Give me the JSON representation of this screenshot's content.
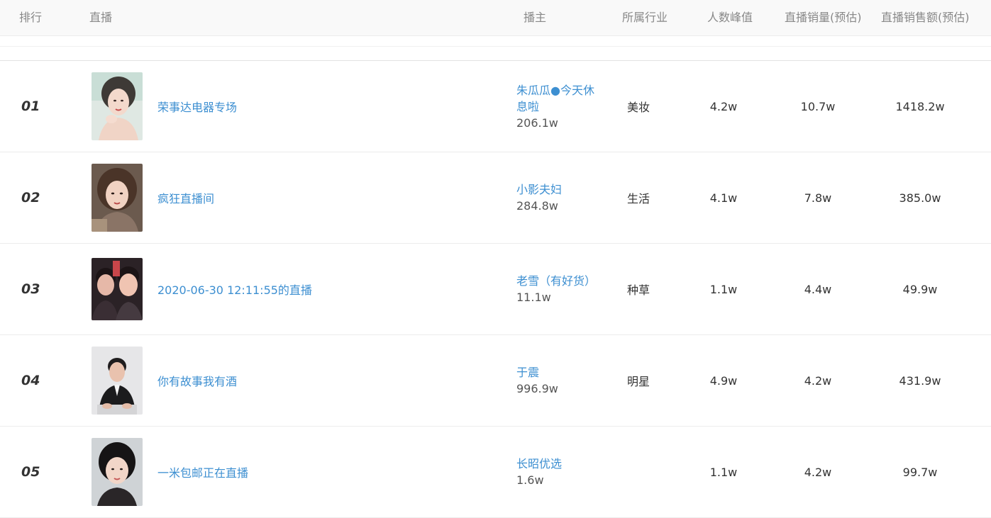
{
  "header": {
    "rank": "排行",
    "live": "直播",
    "anchor": "播主",
    "industry": "所属行业",
    "peak": "人数峰值",
    "sales": "直播销量(预估)",
    "amount": "直播销售额(预估)"
  },
  "rows": [
    {
      "rank": "01",
      "title": "荣事达电器专场",
      "anchor_name": "朱瓜瓜●今天休息啦",
      "anchor_fans": "206.1w",
      "industry": "美妆",
      "peak": "4.2w",
      "sales": "10.7w",
      "amount": "1418.2w"
    },
    {
      "rank": "02",
      "title": "疯狂直播间",
      "anchor_name": "小影夫妇",
      "anchor_fans": "284.8w",
      "industry": "生活",
      "peak": "4.1w",
      "sales": "7.8w",
      "amount": "385.0w"
    },
    {
      "rank": "03",
      "title": "2020-06-30 12:11:55的直播",
      "anchor_name": "老雪（有好货）",
      "anchor_fans": "11.1w",
      "industry": "种草",
      "peak": "1.1w",
      "sales": "4.4w",
      "amount": "49.9w"
    },
    {
      "rank": "04",
      "title": "你有故事我有酒",
      "anchor_name": "于震",
      "anchor_fans": "996.9w",
      "industry": "明星",
      "peak": "4.9w",
      "sales": "4.2w",
      "amount": "431.9w"
    },
    {
      "rank": "05",
      "title": "一米包邮正在直播",
      "anchor_name": "长昭优选",
      "anchor_fans": "1.6w",
      "industry": "",
      "peak": "1.1w",
      "sales": "4.2w",
      "amount": "99.7w"
    }
  ],
  "colors": {
    "link": "#3d8fd1",
    "header_bg": "#f9f9f9",
    "header_text": "#888888",
    "text": "#333333"
  }
}
